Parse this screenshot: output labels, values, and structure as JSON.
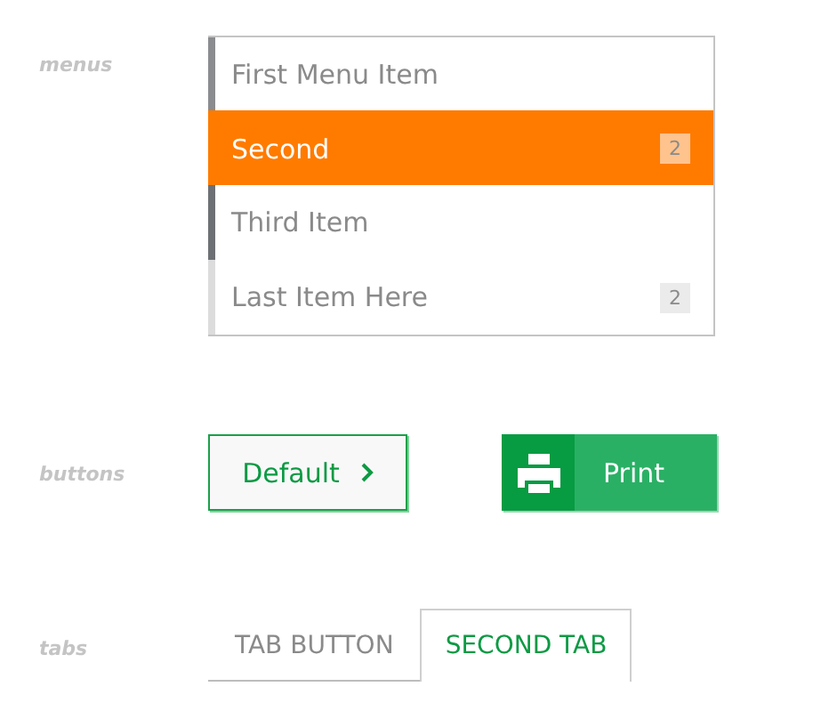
{
  "sections": [
    {
      "label": "menus",
      "kind": "menu",
      "items": [
        {
          "text": "First Menu Item",
          "selected": false,
          "color": "#8a8c8f"
        },
        {
          "text": "Second",
          "selected": true,
          "badge": "2",
          "color": "#ff7b00"
        },
        {
          "text": "Third Item",
          "selected": false,
          "color": "#6d7074"
        },
        {
          "text": "Last Item Here",
          "selected": false,
          "badge": "2",
          "color": "#dcdcdc"
        }
      ]
    },
    {
      "label": "buttons",
      "kind": "buttons",
      "default_button": {
        "text": "Default"
      },
      "print_button": {
        "text": "Print"
      }
    },
    {
      "label": "tabs",
      "kind": "tabs",
      "tabs": [
        {
          "text": "TAB BUTTON",
          "selected": false
        },
        {
          "text": "SECOND TAB",
          "selected": true
        }
      ]
    }
  ]
}
